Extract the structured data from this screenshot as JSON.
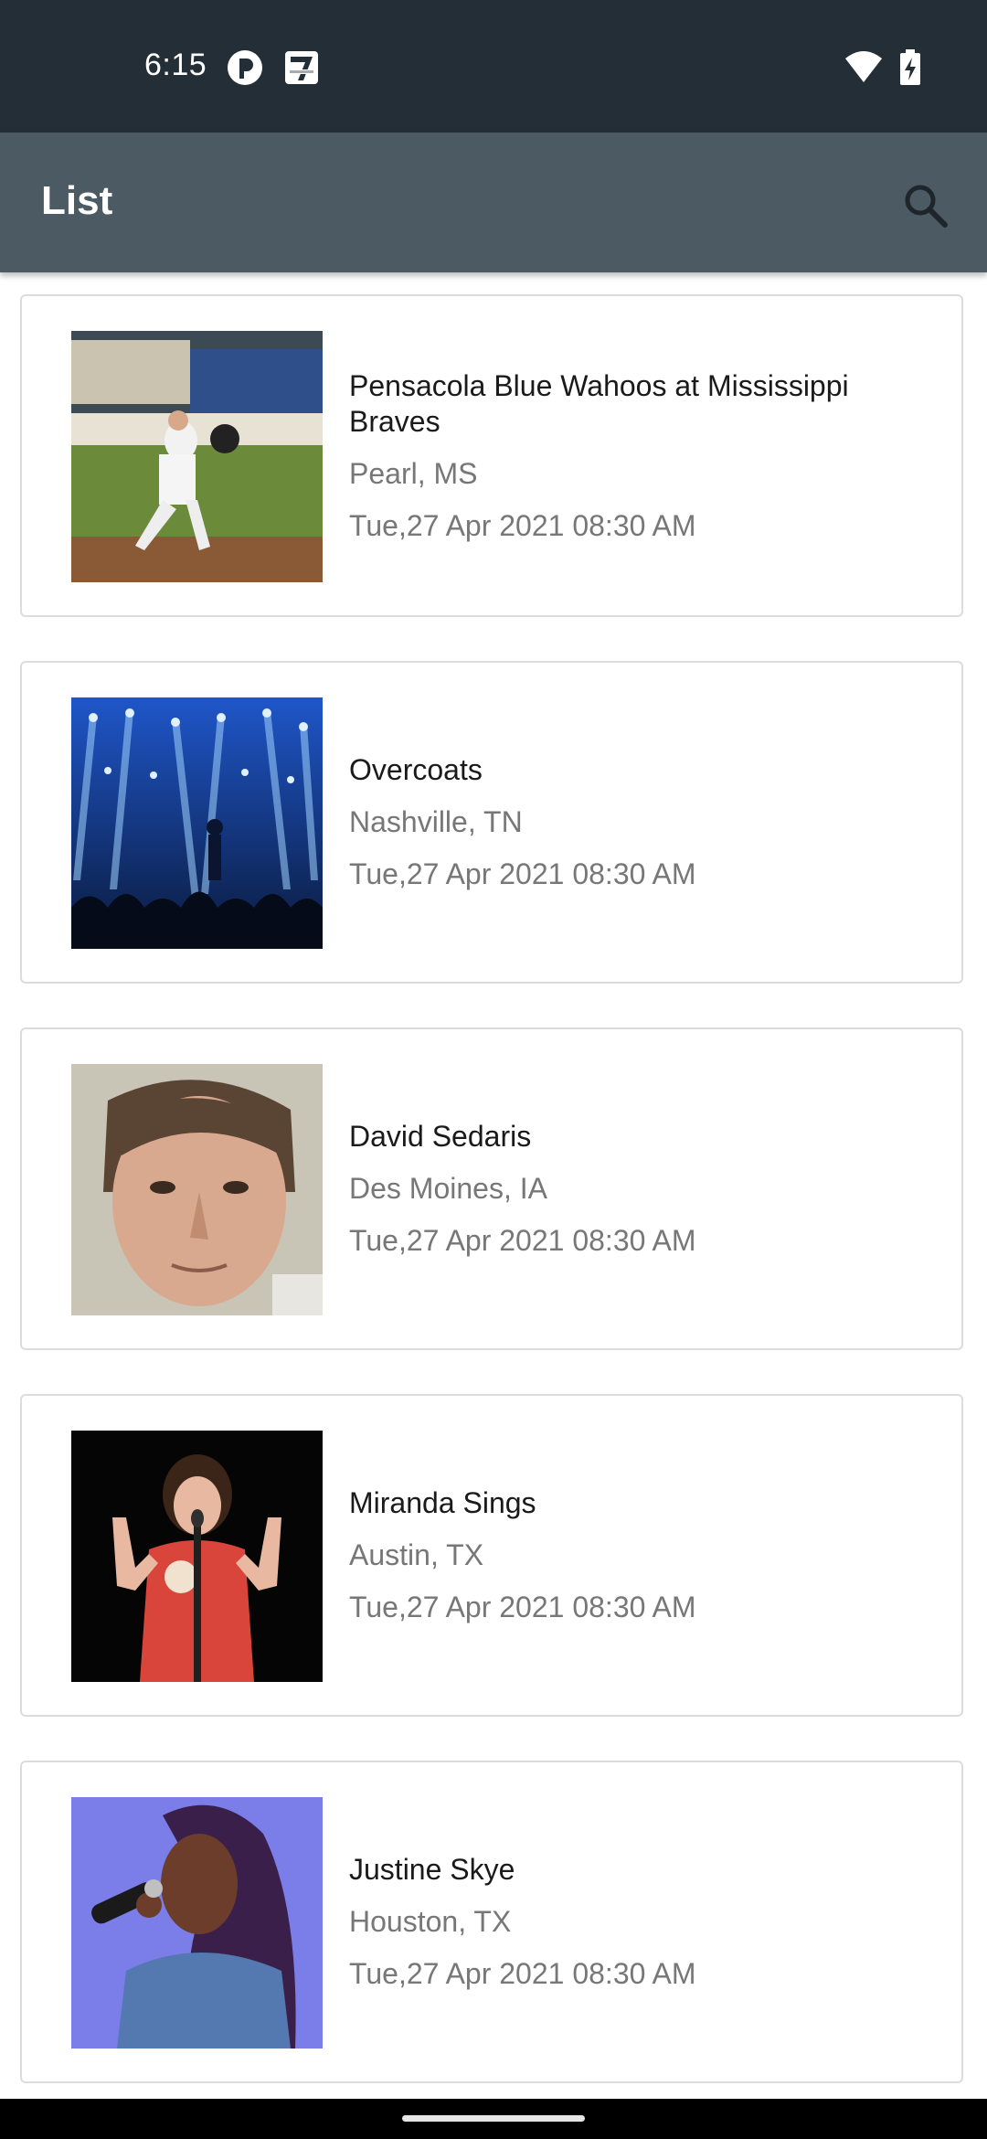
{
  "status_bar": {
    "time": "6:15",
    "left_icons": [
      "app-notification-icon",
      "seven-eleven-icon"
    ],
    "right_icons": [
      "wifi-icon",
      "battery-charging-icon"
    ]
  },
  "app_bar": {
    "title": "List",
    "search_icon": "search-icon"
  },
  "events": [
    {
      "title": "Pensacola Blue Wahoos at Mississippi Braves",
      "location": "Pearl, MS",
      "datetime": "Tue,27 Apr 2021 08:30 AM",
      "image": "baseball-player-photo"
    },
    {
      "title": "Overcoats",
      "location": "Nashville, TN",
      "datetime": "Tue,27 Apr 2021 08:30 AM",
      "image": "concert-stage-photo"
    },
    {
      "title": "David Sedaris",
      "location": "Des Moines, IA",
      "datetime": "Tue,27 Apr 2021 08:30 AM",
      "image": "portrait-photo"
    },
    {
      "title": "Miranda Sings",
      "location": "Austin, TX",
      "datetime": "Tue,27 Apr 2021 08:30 AM",
      "image": "comedian-performer-photo"
    },
    {
      "title": "Justine Skye",
      "location": "Houston, TX",
      "datetime": "Tue,27 Apr 2021 08:30 AM",
      "image": "singer-performer-photo"
    }
  ],
  "colors": {
    "status_bar": "#232e36",
    "app_bar": "#4b5a63",
    "card_border": "#dcdcdc",
    "title_text": "#1a1a1a",
    "secondary_text": "#777777"
  }
}
